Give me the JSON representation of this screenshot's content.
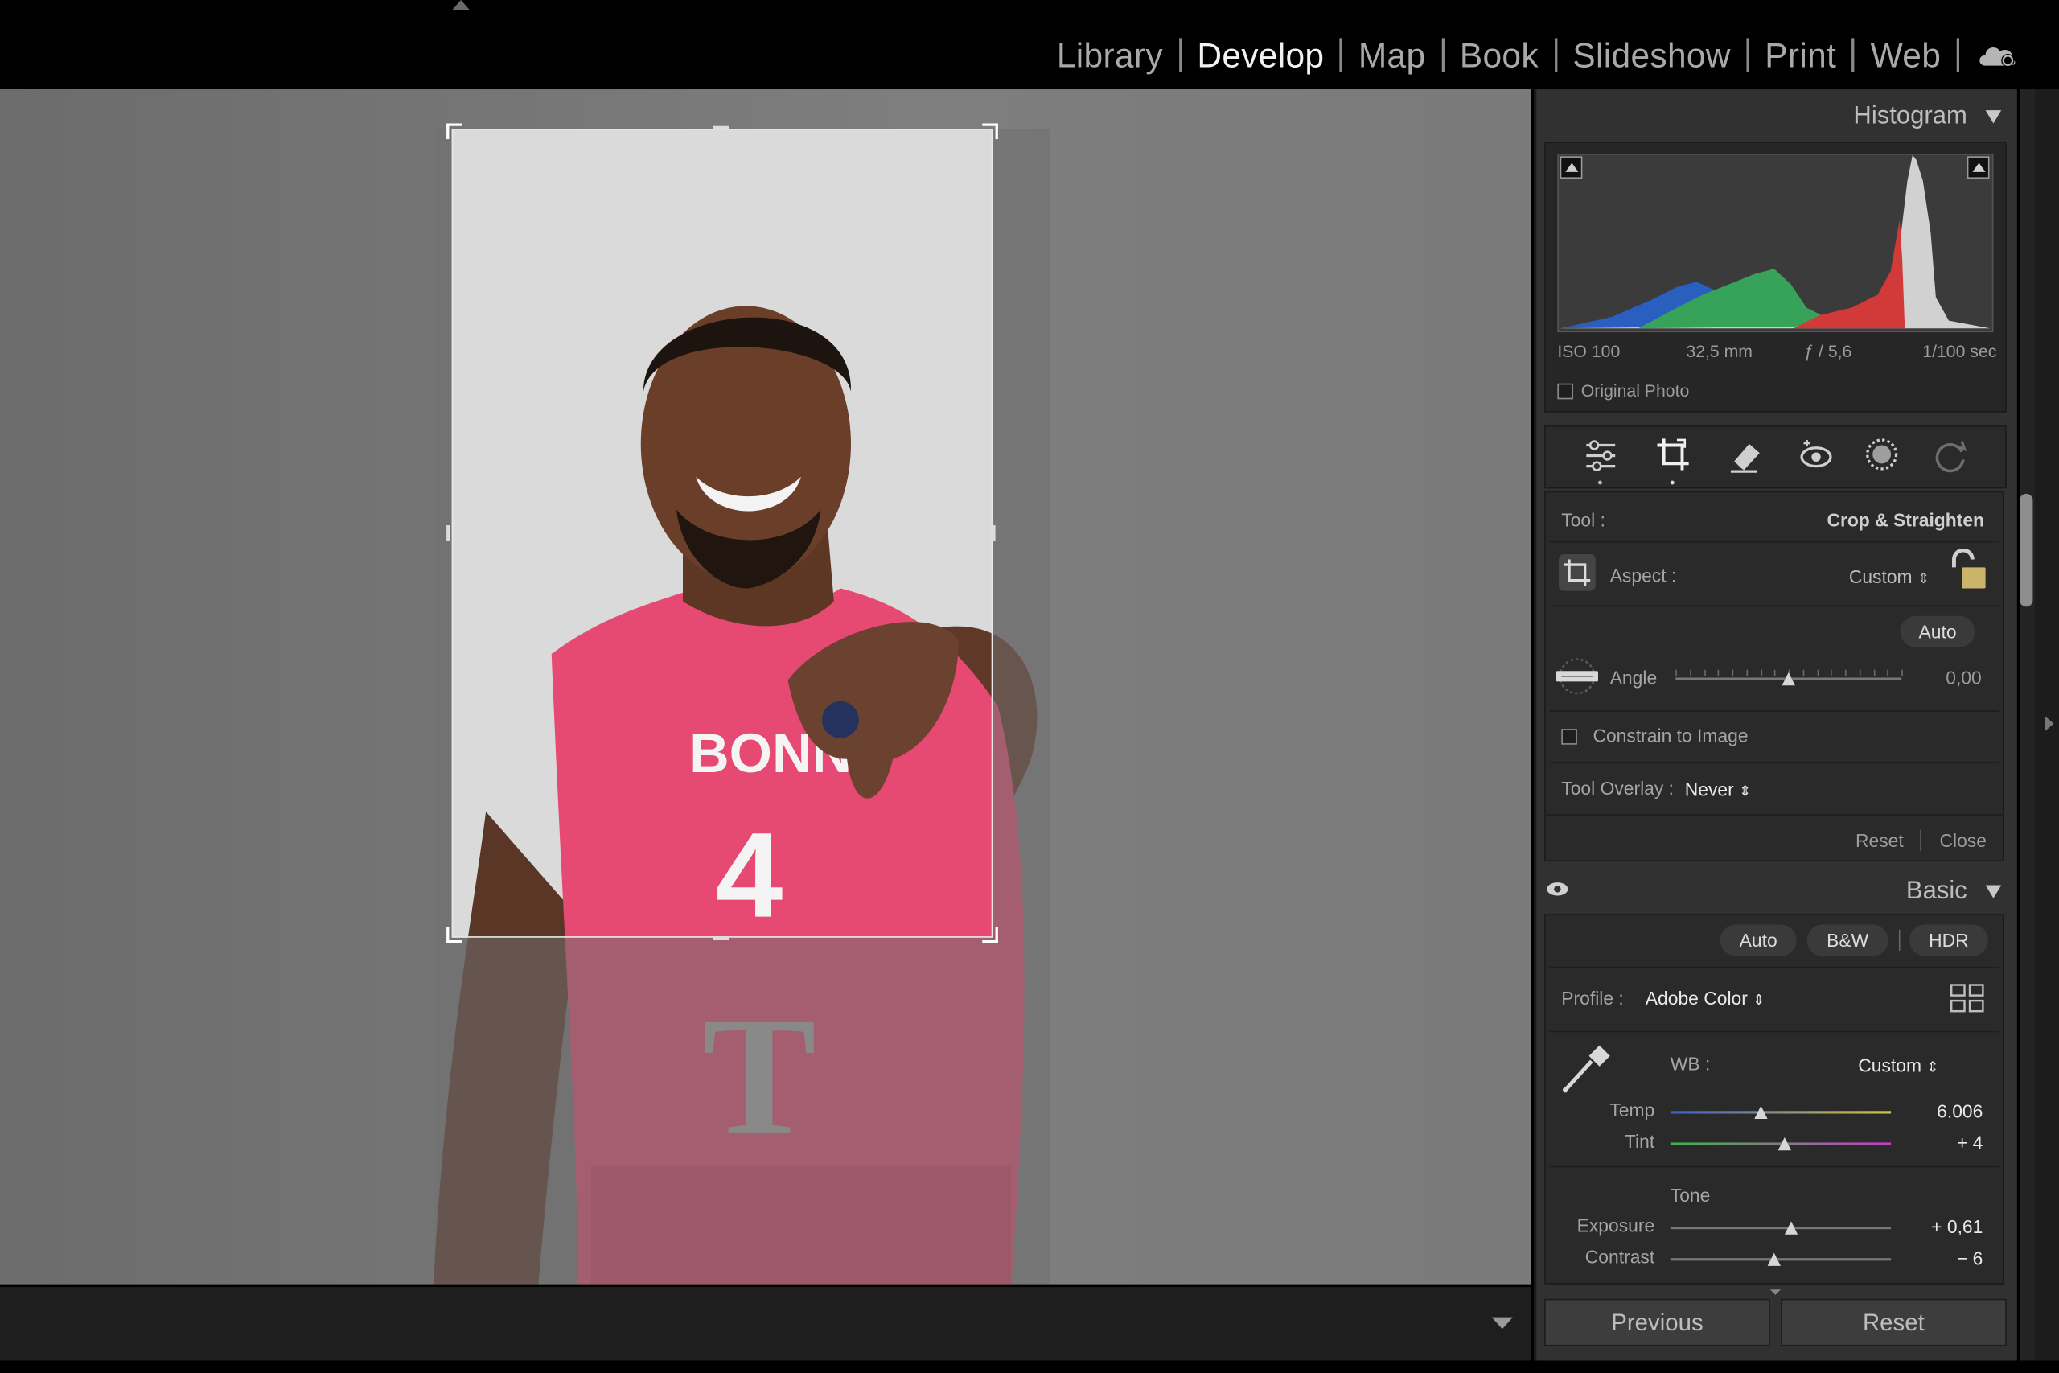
{
  "modules": [
    "Library",
    "Develop",
    "Map",
    "Book",
    "Slideshow",
    "Print",
    "Web"
  ],
  "active_module": "Develop",
  "icons": {
    "cloud": "cloud-sync-icon",
    "top": "panel-collapse-arrow-icon"
  },
  "histogram": {
    "title": "Histogram",
    "iso": "ISO 100",
    "focal": "32,5 mm",
    "aperture": "ƒ / 5,6",
    "shutter": "1/100 sec",
    "original_photo": "Original Photo"
  },
  "crop": {
    "tool_label": "Tool :",
    "tool_value": "Crop & Straighten",
    "aspect_label": "Aspect :",
    "aspect_value": "Custom",
    "auto": "Auto",
    "angle_label": "Angle",
    "angle_value": "0,00",
    "constrain": "Constrain to Image",
    "overlay_label": "Tool Overlay :",
    "overlay_value": "Never",
    "reset": "Reset",
    "close": "Close"
  },
  "basic": {
    "title": "Basic",
    "auto": "Auto",
    "bw": "B&W",
    "hdr": "HDR",
    "profile_label": "Profile :",
    "profile_value": "Adobe Color",
    "wb_label": "WB :",
    "wb_value": "Custom",
    "temp_label": "Temp",
    "temp_value": "6.006",
    "tint_label": "Tint",
    "tint_value": "+ 4",
    "tone_label": "Tone",
    "exposure_label": "Exposure",
    "exposure_value": "+ 0,61",
    "contrast_label": "Contrast",
    "contrast_value": "− 6"
  },
  "slider_levels": {
    "angle": 0.5,
    "temp": 0.41,
    "tint": 0.52,
    "exposure": 0.55,
    "contrast": 0.47
  },
  "buttons": {
    "previous": "Previous",
    "reset": "Reset"
  },
  "jersey": {
    "text": "BONN",
    "number": "4",
    "sponsor": "T"
  }
}
